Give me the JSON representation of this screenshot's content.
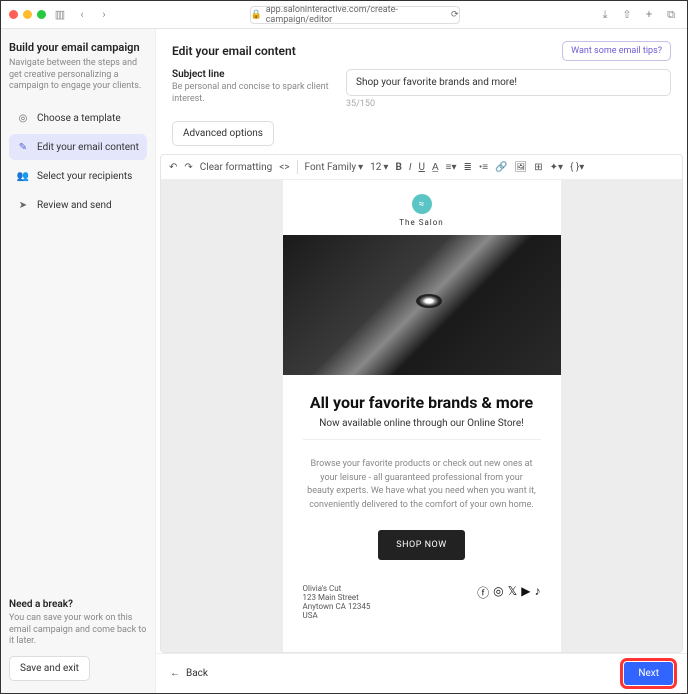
{
  "browser": {
    "url": "app.saloninteractive.com/create-campaign/editor"
  },
  "sidebar": {
    "title": "Build your email campaign",
    "desc": "Navigate between the steps and get creative personalizing a campaign to engage your clients.",
    "items": [
      {
        "label": "Choose a template"
      },
      {
        "label": "Edit your email content"
      },
      {
        "label": "Select your recipients"
      },
      {
        "label": "Review and send"
      }
    ],
    "break_title": "Need a break?",
    "break_desc": "You can save your work on this email campaign and come back to it later.",
    "save": "Save and exit"
  },
  "header": {
    "title": "Edit your email content",
    "tips": "Want some email tips?"
  },
  "subject": {
    "label": "Subject line",
    "hint": "Be personal and concise to spark client interest.",
    "value": "Shop your favorite brands and more!",
    "count": "35/150"
  },
  "advanced": "Advanced options",
  "toolbar": {
    "clear": "Clear formatting",
    "font": "Font Family",
    "size": "12"
  },
  "email": {
    "logo": "The Salon",
    "h1": "All your favorite brands & more",
    "h2": "Now available online through our Online Store!",
    "body": "Browse your favorite products or check out new ones at your leisure - all guaranteed professional from your beauty experts. We have what you need when you want it, conveniently delivered to the comfort of your own home.",
    "cta": "SHOP NOW",
    "addr_name": "Olivia's Cut",
    "addr_street": "123 Main Street",
    "addr_city": "Anytown CA 12345",
    "addr_country": "USA"
  },
  "footer": {
    "back": "Back",
    "next": "Next"
  }
}
